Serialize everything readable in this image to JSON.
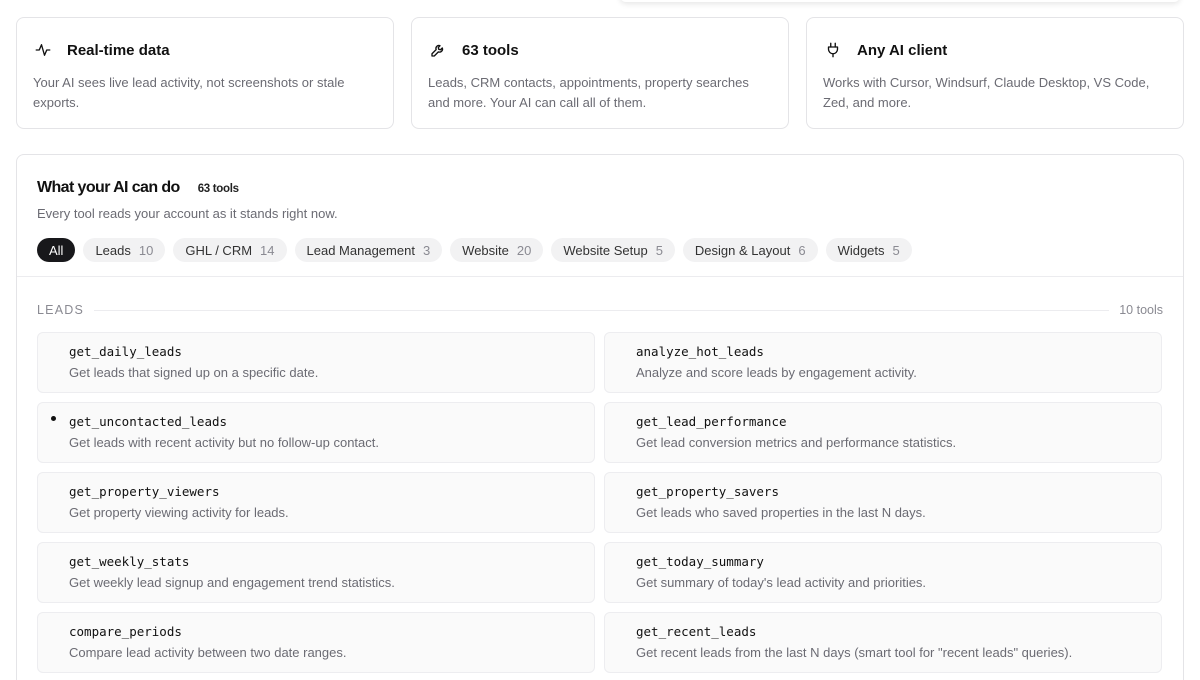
{
  "features": [
    {
      "icon": "activity-icon",
      "title": "Real-time data",
      "desc": "Your AI sees live lead activity, not screenshots or stale exports."
    },
    {
      "icon": "wrench-icon",
      "title": "63 tools",
      "desc": "Leads, CRM contacts, appointments, property searches and more. Your AI can call all of them."
    },
    {
      "icon": "plug-icon",
      "title": "Any AI client",
      "desc": "Works with Cursor, Windsurf, Claude Desktop, VS Code, Zed, and more."
    }
  ],
  "panel": {
    "title": "What your AI can do",
    "tools_count": "63 tools",
    "subtitle": "Every tool reads your account as it stands right now."
  },
  "filters": [
    {
      "label": "All",
      "count": "",
      "active": true
    },
    {
      "label": "Leads",
      "count": "10"
    },
    {
      "label": "GHL / CRM",
      "count": "14"
    },
    {
      "label": "Lead Management",
      "count": "3"
    },
    {
      "label": "Website",
      "count": "20"
    },
    {
      "label": "Website Setup",
      "count": "5"
    },
    {
      "label": "Design & Layout",
      "count": "6"
    },
    {
      "label": "Widgets",
      "count": "5"
    }
  ],
  "section": {
    "label": "LEADS",
    "count": "10 tools"
  },
  "tools": [
    {
      "name": "get_daily_leads",
      "desc": "Get leads that signed up on a specific date."
    },
    {
      "name": "analyze_hot_leads",
      "desc": "Analyze and score leads by engagement activity."
    },
    {
      "name": "get_uncontacted_leads",
      "desc": "Get leads with recent activity but no follow-up contact."
    },
    {
      "name": "get_lead_performance",
      "desc": "Get lead conversion metrics and performance statistics."
    },
    {
      "name": "get_property_viewers",
      "desc": "Get property viewing activity for leads."
    },
    {
      "name": "get_property_savers",
      "desc": "Get leads who saved properties in the last N days."
    },
    {
      "name": "get_weekly_stats",
      "desc": "Get weekly lead signup and engagement trend statistics."
    },
    {
      "name": "get_today_summary",
      "desc": "Get summary of today's lead activity and priorities."
    },
    {
      "name": "compare_periods",
      "desc": "Compare lead activity between two date ranges."
    },
    {
      "name": "get_recent_leads",
      "desc": "Get recent leads from the last N days (smart tool for \"recent leads\" queries)."
    }
  ]
}
